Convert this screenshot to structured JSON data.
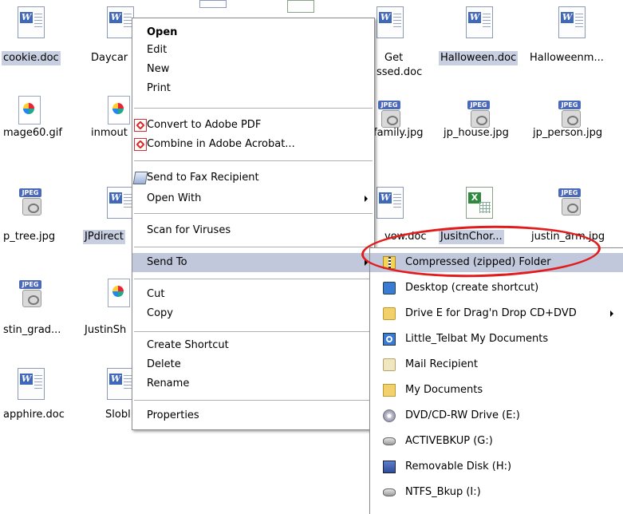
{
  "desktop": {
    "files": [
      {
        "label": "cookie.doc",
        "type": "doc",
        "selected": true
      },
      {
        "label": "Daycar",
        "type": "doc",
        "selected": false
      },
      {
        "label": "",
        "type": "doc-partial",
        "selected": false
      },
      {
        "label": "",
        "type": "xls-partial",
        "selected": false
      },
      {
        "label": "Get",
        "label2": "ssed.doc",
        "type": "doc",
        "selected": false
      },
      {
        "label": "Halloween.doc",
        "type": "doc",
        "selected": true
      },
      {
        "label": "Halloweenm...",
        "type": "doc",
        "selected": false
      },
      {
        "label": "mage60.gif",
        "type": "gif",
        "selected": false
      },
      {
        "label": "inmout",
        "type": "gif",
        "selected": false
      },
      {
        "label": "family.jpg",
        "type": "jpg",
        "selected": false
      },
      {
        "label": "jp_house.jpg",
        "type": "jpg",
        "selected": false
      },
      {
        "label": "jp_person.jpg",
        "type": "jpg",
        "selected": false
      },
      {
        "label": "p_tree.jpg",
        "type": "jpg",
        "selected": false
      },
      {
        "label": "JPdirect",
        "type": "doc",
        "selected": true
      },
      {
        "label": "vow.doc",
        "type": "doc",
        "selected": false
      },
      {
        "label": "JusitnChor...",
        "type": "xls",
        "selected": true
      },
      {
        "label": "justin_arm.jpg",
        "type": "jpg",
        "selected": false
      },
      {
        "label": "stin_grad...",
        "type": "jpg",
        "selected": false
      },
      {
        "label": "JustinSh",
        "type": "gif",
        "selected": false
      },
      {
        "label": "apphire.doc",
        "type": "doc",
        "selected": false
      },
      {
        "label": "Slobl",
        "type": "doc",
        "selected": false
      }
    ]
  },
  "context_menu": {
    "open": "Open",
    "edit": "Edit",
    "new": "New",
    "print": "Print",
    "convert_pdf": "Convert to Adobe PDF",
    "combine_acrobat": "Combine in Adobe Acrobat...",
    "send_fax": "Send to Fax Recipient",
    "open_with": "Open With",
    "scan_viruses": "Scan for Viruses",
    "send_to": "Send To",
    "cut": "Cut",
    "copy": "Copy",
    "create_shortcut": "Create Shortcut",
    "delete": "Delete",
    "rename": "Rename",
    "properties": "Properties"
  },
  "send_to_menu": {
    "compressed": "Compressed (zipped) Folder",
    "desktop": "Desktop (create shortcut)",
    "drive_e": "Drive E for Drag'n Drop CD+DVD",
    "telbat_docs": "Little_Telbat My Documents",
    "mail": "Mail Recipient",
    "my_docs": "My Documents",
    "dvd": "DVD/CD-RW Drive (E:)",
    "activebkup": "ACTIVEBKUP (G:)",
    "removable": "Removable Disk (H:)",
    "ntfs": "NTFS_Bkup (I:)"
  },
  "colors": {
    "menu_highlight": "#c1c8dc",
    "selection": "#c8cfe0",
    "annotation_circle": "#e21c1c"
  }
}
